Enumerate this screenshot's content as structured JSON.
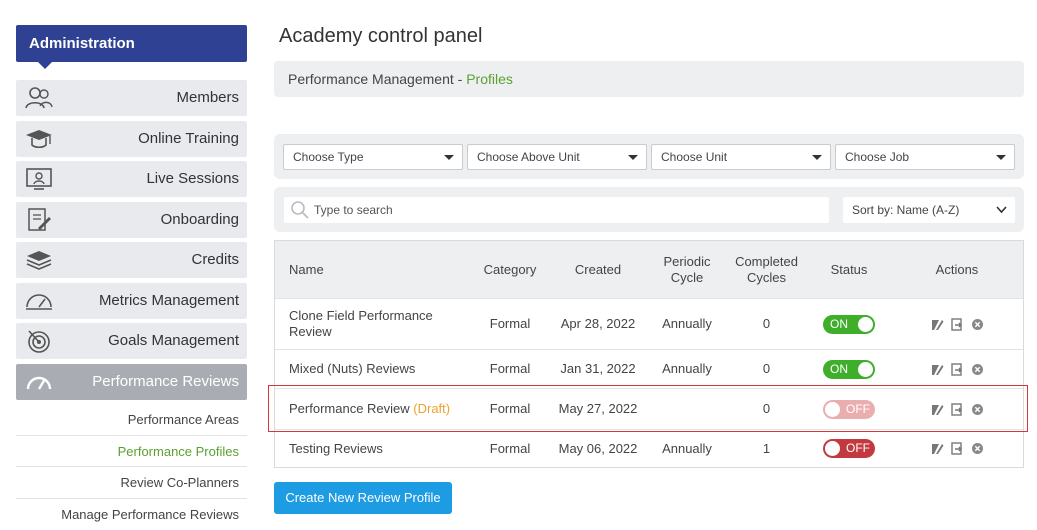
{
  "sidebar": {
    "title": "Administration",
    "items": [
      {
        "label": "Members",
        "icon": "members-icon"
      },
      {
        "label": "Online Training",
        "icon": "graduation-cap-icon"
      },
      {
        "label": "Live Sessions",
        "icon": "presentation-screen-icon"
      },
      {
        "label": "Onboarding",
        "icon": "checklist-pen-icon"
      },
      {
        "label": "Credits",
        "icon": "stacked-layers-icon"
      },
      {
        "label": "Metrics Management",
        "icon": "gauge-icon"
      },
      {
        "label": "Goals Management",
        "icon": "target-icon"
      },
      {
        "label": "Performance Reviews",
        "icon": "speedometer-icon",
        "active": true
      }
    ],
    "sub_items": [
      {
        "label": "Performance Areas"
      },
      {
        "label": "Performance Profiles",
        "active": true
      },
      {
        "label": "Review Co-Planners"
      },
      {
        "label": "Manage Performance Reviews"
      }
    ]
  },
  "page": {
    "title": "Academy control panel",
    "breadcrumb_parent": "Performance Management - ",
    "breadcrumb_current": "Profiles"
  },
  "filters": {
    "type": "Choose Type",
    "above_unit": "Choose Above Unit",
    "unit": "Choose Unit",
    "job": "Choose Job"
  },
  "search": {
    "placeholder": "Type to search",
    "sort_label": "Sort by: Name (A-Z)"
  },
  "table": {
    "headers": {
      "name": "Name",
      "category": "Category",
      "created": "Created",
      "periodic": "Periodic Cycle",
      "completed": "Completed Cycles",
      "status": "Status",
      "actions": "Actions"
    },
    "rows": [
      {
        "name": "Clone Field Performance Review",
        "draft": "",
        "category": "Formal",
        "created": "Apr 28, 2022",
        "periodic": "Annually",
        "completed": "0",
        "status": "ON"
      },
      {
        "name": "Mixed (Nuts) Reviews",
        "draft": "",
        "category": "Formal",
        "created": "Jan 31, 2022",
        "periodic": "Annually",
        "completed": "0",
        "status": "ON"
      },
      {
        "name": "Performance Review",
        "draft": "(Draft)",
        "category": "Formal",
        "created": "May 27, 2022",
        "periodic": "",
        "completed": "0",
        "status": "OFF"
      },
      {
        "name": "Testing Reviews",
        "draft": "",
        "category": "Formal",
        "created": "May 06, 2022",
        "periodic": "Annually",
        "completed": "1",
        "status": "OFF"
      }
    ]
  },
  "create_button": "Create New Review Profile",
  "colors": {
    "brand": "#2f4192",
    "accent_green": "#5aa130",
    "toggle_on": "#3fae2a",
    "toggle_off": "#c23a3f",
    "draft": "#f0a030",
    "primary_button": "#1d9be3",
    "highlight": "#d63636"
  }
}
